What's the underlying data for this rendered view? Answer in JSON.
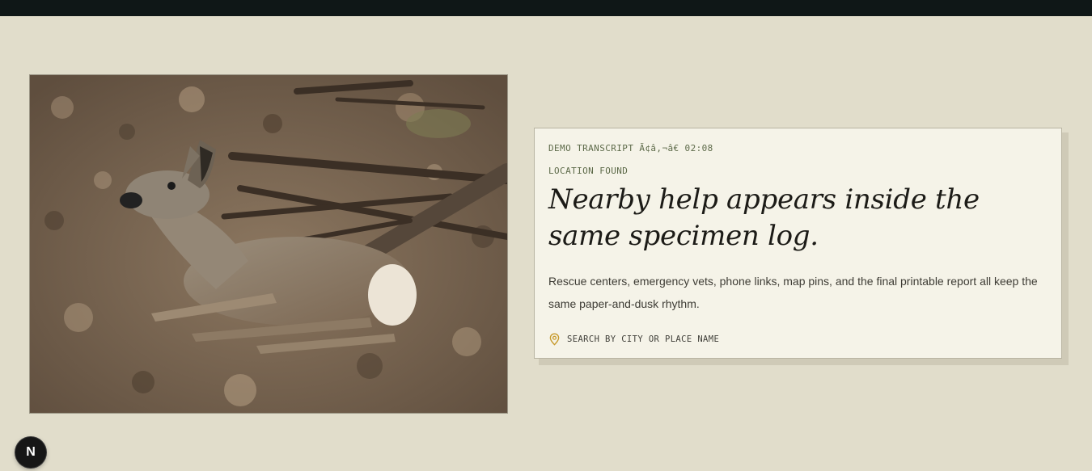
{
  "header": {
    "bar_color": "#0f1717"
  },
  "photo": {
    "icon": "deer-photo"
  },
  "card": {
    "kicker": "DEMO TRANSCRIPT Ã¢â‚¬â€ 02:08",
    "label": "LOCATION FOUND",
    "headline": "Nearby help appears inside the same specimen log.",
    "body": "Rescue centers, emergency vets, phone links, map pins, and the final printable report all keep the same paper-and-dusk rhythm.",
    "search": {
      "icon": "map-pin-icon",
      "label": "SEARCH BY CITY OR PLACE NAME"
    }
  },
  "dev_badge": {
    "letter": "N"
  },
  "colors": {
    "background": "#e1ddcb",
    "card": "#f5f3e8",
    "accent_olive": "#5d6a49",
    "pin_gold": "#c79a2c"
  }
}
